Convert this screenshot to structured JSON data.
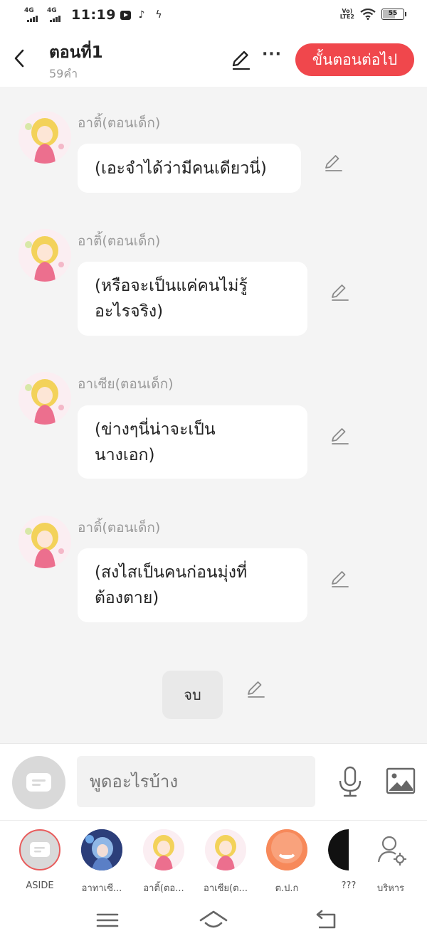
{
  "status_bar": {
    "network1": "4G",
    "network2": "4G",
    "time": "11:19",
    "volte": "Vo) LTE2",
    "battery": "55"
  },
  "header": {
    "title": "ตอนที่1",
    "word_count": "59คำ",
    "next_label": "ขั้นตอนต่อไป",
    "more_label": "···"
  },
  "messages": [
    {
      "speaker": "อาติ้(ตอนเด็ก)",
      "line1": "(เอะจำได้ว่ามีคนเดียวนี่)",
      "line2": ""
    },
    {
      "speaker": "อาติ้(ตอนเด็ก)",
      "line1": "(หรือจะเป็นแค่คนไม่รู้",
      "line2": "อะไรจริง)"
    },
    {
      "speaker": "อาเซีย(ตอนเด็ก)",
      "line1": "(ข่างๆนี่น่าจะเป็น",
      "line2": "นางเอก)"
    },
    {
      "speaker": "อาติ้(ตอนเด็ก)",
      "line1": "(สงไสเป็นคนก่อนมุ่งที่",
      "line2": "ต้องตาย)"
    }
  ],
  "end_label": "จบ",
  "input": {
    "placeholder": "พูดอะไรบ้าง"
  },
  "characters": [
    {
      "name": "ASIDE"
    },
    {
      "name": "อาทาเซี..."
    },
    {
      "name": "อาติ้(ตอ..."
    },
    {
      "name": "อาเซีย(ต..."
    },
    {
      "name": "ต.ป.ก"
    },
    {
      "name": "???"
    },
    {
      "name": "บริหาร"
    }
  ],
  "colors": {
    "accent": "#f0474c",
    "chat_bg": "#f4f4f4",
    "muted_text": "#9a9a9a"
  }
}
